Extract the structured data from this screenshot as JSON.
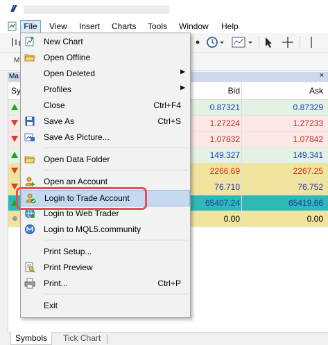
{
  "menubar": {
    "items": [
      "File",
      "View",
      "Insert",
      "Charts",
      "Tools",
      "Window",
      "Help"
    ]
  },
  "market_watch": {
    "title": "Ma",
    "close": "×",
    "columns": {
      "symbol": "Sy",
      "bid": "Bid",
      "ask": "Ask"
    },
    "rows": [
      {
        "dir": "up",
        "bid": "0.87321",
        "ask": "0.87329",
        "bg": "#e3f2e3",
        "color": "#1a3cb5"
      },
      {
        "dir": "down",
        "bid": "1.27224",
        "ask": "1.27233",
        "bg": "#fbe7e5",
        "color": "#c1301f"
      },
      {
        "dir": "down",
        "bid": "1.07832",
        "ask": "1.07842",
        "bg": "#fbe7e5",
        "color": "#c1301f"
      },
      {
        "dir": "up",
        "bid": "149.327",
        "ask": "149.341",
        "bg": "#e3f2e3",
        "color": "#1a3cb5"
      },
      {
        "dir": "down",
        "bid": "2266.69",
        "ask": "2267.25",
        "bg": "#f1e39c",
        "color": "#c1301f"
      },
      {
        "dir": "down",
        "bid": "76.710",
        "ask": "76.752",
        "bg": "#f1e39c",
        "color": "#1a3cb5"
      },
      {
        "dir": "up",
        "bid": "65407.24",
        "ask": "65419.66",
        "bg": "#2db9b4",
        "color": "#1a3cb5"
      },
      {
        "dir": "neutral",
        "bid": "0.00",
        "ask": "0.00",
        "bg": "#f1e39c",
        "color": "#000000"
      }
    ]
  },
  "file_menu": {
    "items": [
      {
        "label": "New Chart",
        "icon": "new-chart-icon"
      },
      {
        "label": "Open Offline",
        "icon": "folder-icon"
      },
      {
        "label": "Open Deleted",
        "submenu": true
      },
      {
        "label": "Profiles",
        "submenu": true
      },
      {
        "label": "Close",
        "shortcut": "Ctrl+F4"
      },
      {
        "label": "Save As",
        "shortcut": "Ctrl+S",
        "icon": "floppy-icon"
      },
      {
        "label": "Save As Picture...",
        "icon": "picture-icon"
      },
      {
        "label": "Open Data Folder",
        "icon": "folder-icon"
      },
      {
        "label": "Open an Account",
        "icon": "account-icon"
      },
      {
        "label": "Login to Trade Account",
        "icon": "login-icon",
        "highlighted": true
      },
      {
        "label": "Login to Web Trader",
        "icon": "web-trader-icon"
      },
      {
        "label": "Login to MQL5.community",
        "icon": "mql5-icon"
      },
      {
        "label": "Print Setup..."
      },
      {
        "label": "Print Preview",
        "icon": "print-preview-icon"
      },
      {
        "label": "Print...",
        "shortcut": "Ctrl+P",
        "icon": "printer-icon"
      },
      {
        "label": "Exit"
      }
    ]
  },
  "tabs": [
    "Symbols",
    "Tick Chart"
  ],
  "colors": {
    "highlight_ring": "#e0525a",
    "menu_highlight": "#c5daf0"
  }
}
